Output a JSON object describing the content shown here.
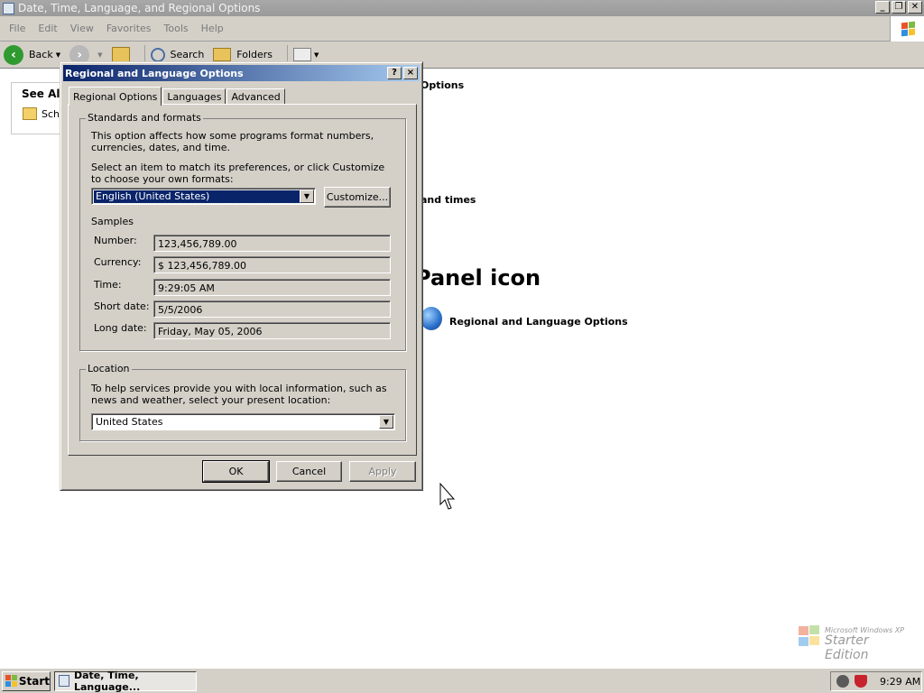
{
  "main_window": {
    "title": "Date, Time, Language, and Regional Options",
    "menu": [
      "File",
      "Edit",
      "View",
      "Favorites",
      "Tools",
      "Help"
    ],
    "toolbar": {
      "back_label": "Back",
      "search_label": "Search",
      "folders_label": "Folders"
    },
    "see_also": {
      "heading": "See Als",
      "item": "Sche"
    },
    "bg_task_1": "Options",
    "bg_task_2": "and times",
    "bg_heading": "Panel icon",
    "bg_icon_label": "Regional and Language Options",
    "brand_line1": "Microsoft Windows XP",
    "brand_line2": "Starter Edition"
  },
  "dialog": {
    "title": "Regional and Language Options",
    "help_btn": "?",
    "close_btn": "×",
    "tabs": [
      "Regional Options",
      "Languages",
      "Advanced"
    ],
    "standards": {
      "group_label": "Standards and formats",
      "desc": "This option affects how some programs format numbers, currencies, dates, and time.",
      "select_desc": "Select an item to match its preferences, or click Customize to choose your own formats:",
      "selected_format": "English (United States)",
      "customize_btn": "Customize...",
      "samples_label": "Samples",
      "samples": [
        {
          "label": "Number:",
          "value": "123,456,789.00"
        },
        {
          "label": "Currency:",
          "value": "$ 123,456,789.00"
        },
        {
          "label": "Time:",
          "value": "9:29:05 AM"
        },
        {
          "label": "Short date:",
          "value": "5/5/2006"
        },
        {
          "label": "Long date:",
          "value": "Friday, May 05, 2006"
        }
      ]
    },
    "location": {
      "group_label": "Location",
      "desc": "To help services provide you with local information, such as news and weather, select your present location:",
      "selected": "United States"
    },
    "buttons": {
      "ok": "OK",
      "cancel": "Cancel",
      "apply": "Apply"
    }
  },
  "taskbar": {
    "start": "Start",
    "task": "Date, Time, Language...",
    "clock": "9:29 AM"
  }
}
